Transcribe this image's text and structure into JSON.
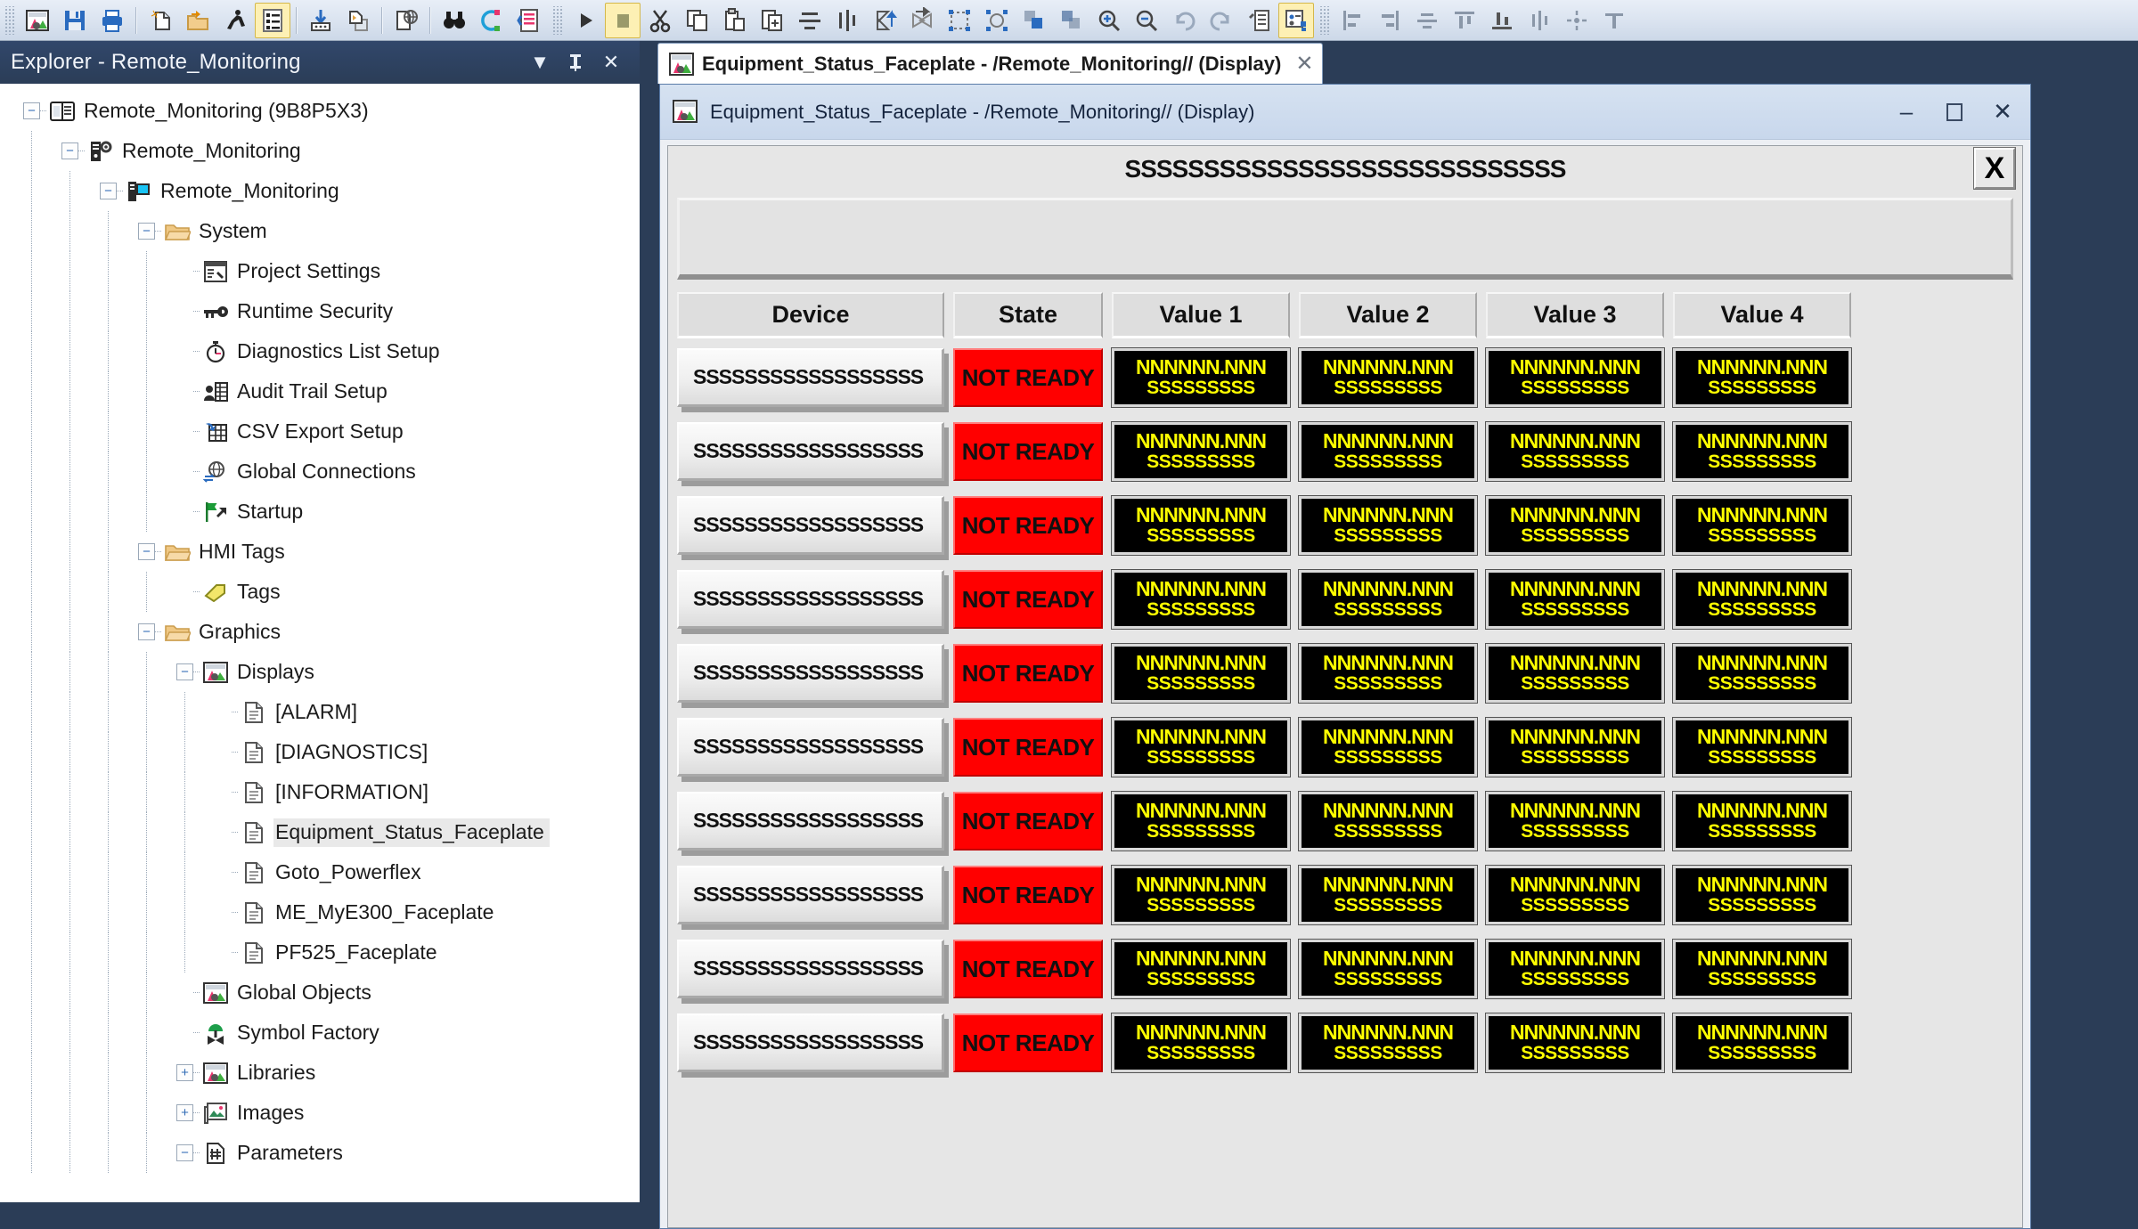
{
  "toolbar": {
    "buttons": [
      {
        "name": "new-display-icon",
        "label": "New Display"
      },
      {
        "name": "save-icon",
        "label": "Save"
      },
      {
        "name": "print-icon",
        "label": "Print"
      },
      {
        "name": "new-file-icon",
        "label": "New"
      },
      {
        "name": "open-folder-icon",
        "label": "Open"
      },
      {
        "name": "run-icon",
        "label": "Test Run"
      },
      {
        "name": "property-list-icon",
        "label": "Property Panel"
      },
      {
        "name": "import-icon",
        "label": "Import"
      },
      {
        "name": "export-icon",
        "label": "Export"
      },
      {
        "name": "web-page-icon",
        "label": "Publish"
      },
      {
        "name": "find-icon",
        "label": "Find"
      },
      {
        "name": "replace-icon",
        "label": "Replace"
      },
      {
        "name": "diagnostics-icon",
        "label": "Diagnostics"
      },
      {
        "name": "play-icon",
        "label": "Run"
      },
      {
        "name": "stop-icon",
        "label": "Stop"
      },
      {
        "name": "cut-icon",
        "label": "Cut"
      },
      {
        "name": "copy-icon",
        "label": "Copy"
      },
      {
        "name": "paste-icon",
        "label": "Paste"
      },
      {
        "name": "duplicate-icon",
        "label": "Duplicate"
      },
      {
        "name": "align-center-horizontal-icon",
        "label": "Align Center"
      },
      {
        "name": "align-center-vertical-icon",
        "label": "Align Middle"
      },
      {
        "name": "flip-vertical-icon",
        "label": "Flip Vertical"
      },
      {
        "name": "flip-horizontal-icon",
        "label": "Flip Horizontal"
      },
      {
        "name": "group-icon",
        "label": "Group"
      },
      {
        "name": "ungroup-icon",
        "label": "Ungroup"
      },
      {
        "name": "bring-front-icon",
        "label": "Bring to Front"
      },
      {
        "name": "send-back-icon",
        "label": "Send to Back"
      },
      {
        "name": "rotate-icon",
        "label": "Rotate"
      },
      {
        "name": "zoom-in-icon",
        "label": "Zoom In"
      },
      {
        "name": "zoom-out-icon",
        "label": "Zoom Out"
      },
      {
        "name": "undo-icon",
        "label": "Undo"
      },
      {
        "name": "redo-icon",
        "label": "Redo"
      },
      {
        "name": "tag-browser-icon",
        "label": "Tag Browser"
      },
      {
        "name": "object-explorer-icon",
        "label": "Object Explorer"
      },
      {
        "name": "align-left-icon",
        "label": "Align Left"
      },
      {
        "name": "align-right-icon",
        "label": "Align Right"
      },
      {
        "name": "distribute-horizontal-icon",
        "label": "Distribute Horizontally"
      },
      {
        "name": "align-top-icon",
        "label": "Align Top"
      },
      {
        "name": "align-bottom-icon",
        "label": "Align Bottom"
      },
      {
        "name": "distribute-vertical-icon",
        "label": "Distribute Vertically"
      },
      {
        "name": "center-point-icon",
        "label": "Center"
      },
      {
        "name": "align-middle-icon",
        "label": "Align Middle"
      }
    ]
  },
  "explorer": {
    "title": "Explorer - Remote_Monitoring",
    "dropdown_glyph": "▼",
    "pin_glyph": "฿",
    "close_glyph": "✕",
    "tree": [
      {
        "label": "Remote_Monitoring (9B8P5X3)",
        "depth": 0,
        "toggle": "minus",
        "icon": "application-icon"
      },
      {
        "label": "Remote_Monitoring",
        "depth": 1,
        "toggle": "minus",
        "icon": "server-gear-icon"
      },
      {
        "label": "Remote_Monitoring",
        "depth": 2,
        "toggle": "minus",
        "icon": "server-display-icon"
      },
      {
        "label": "System",
        "depth": 3,
        "toggle": "minus",
        "icon": "folder-icon"
      },
      {
        "label": "Project Settings",
        "depth": 4,
        "toggle": "none",
        "icon": "project-settings-icon"
      },
      {
        "label": "Runtime Security",
        "depth": 4,
        "toggle": "none",
        "icon": "key-icon"
      },
      {
        "label": "Diagnostics List Setup",
        "depth": 4,
        "toggle": "none",
        "icon": "stopwatch-icon"
      },
      {
        "label": "Audit Trail Setup",
        "depth": 4,
        "toggle": "none",
        "icon": "audit-trail-icon"
      },
      {
        "label": "CSV Export Setup",
        "depth": 4,
        "toggle": "none",
        "icon": "csv-export-icon"
      },
      {
        "label": "Global Connections",
        "depth": 4,
        "toggle": "none",
        "icon": "globe-connections-icon"
      },
      {
        "label": "Startup",
        "depth": 4,
        "toggle": "none",
        "icon": "startup-flag-icon"
      },
      {
        "label": "HMI Tags",
        "depth": 3,
        "toggle": "minus",
        "icon": "folder-icon"
      },
      {
        "label": "Tags",
        "depth": 4,
        "toggle": "none",
        "icon": "tag-icon"
      },
      {
        "label": "Graphics",
        "depth": 3,
        "toggle": "minus",
        "icon": "folder-icon"
      },
      {
        "label": "Displays",
        "depth": 4,
        "toggle": "minus",
        "icon": "display-icon"
      },
      {
        "label": "[ALARM]",
        "depth": 5,
        "toggle": "none",
        "icon": "document-icon"
      },
      {
        "label": "[DIAGNOSTICS]",
        "depth": 5,
        "toggle": "none",
        "icon": "document-icon"
      },
      {
        "label": "[INFORMATION]",
        "depth": 5,
        "toggle": "none",
        "icon": "document-icon"
      },
      {
        "label": "Equipment_Status_Faceplate",
        "depth": 5,
        "toggle": "none",
        "icon": "document-icon",
        "selected": true
      },
      {
        "label": "Goto_Powerflex",
        "depth": 5,
        "toggle": "none",
        "icon": "document-icon"
      },
      {
        "label": "ME_MyE300_Faceplate",
        "depth": 5,
        "toggle": "none",
        "icon": "document-icon"
      },
      {
        "label": "PF525_Faceplate",
        "depth": 5,
        "toggle": "none",
        "icon": "document-icon"
      },
      {
        "label": "Global Objects",
        "depth": 4,
        "toggle": "none",
        "icon": "display-icon"
      },
      {
        "label": "Symbol Factory",
        "depth": 4,
        "toggle": "none",
        "icon": "symbol-factory-icon"
      },
      {
        "label": "Libraries",
        "depth": 4,
        "toggle": "plus",
        "icon": "display-icon"
      },
      {
        "label": "Images",
        "depth": 4,
        "toggle": "plus",
        "icon": "images-icon"
      },
      {
        "label": "Parameters",
        "depth": 4,
        "toggle": "minus",
        "icon": "parameters-icon"
      }
    ]
  },
  "tab": {
    "title": "Equipment_Status_Faceplate - /Remote_Monitoring// (Display)",
    "close_glyph": "✕",
    "icon": "display-icon"
  },
  "mdi_window": {
    "title": "Equipment_Status_Faceplate - /Remote_Monitoring// (Display)",
    "icon": "display-icon",
    "minimize_glyph": "–",
    "maximize_glyph": "☐",
    "close_glyph": "✕"
  },
  "faceplate": {
    "title": "SSSSSSSSSSSSSSSSSSSSSSSSSSSS",
    "close_label": "X",
    "columns": [
      "Device",
      "State",
      "Value 1",
      "Value 2",
      "Value 3",
      "Value 4"
    ],
    "row_device_label": "SSSSSSSSSSSSSSSSSS",
    "row_state_label": "NOT READY",
    "value_top": "NNNNNN.NNN",
    "value_bottom": "SSSSSSSSS",
    "row_count": 10,
    "colors": {
      "state_bg": "#ff0000",
      "value_bg": "#000000",
      "value_fg": "#ffff00",
      "panel_bg": "#e6e6e6"
    }
  }
}
